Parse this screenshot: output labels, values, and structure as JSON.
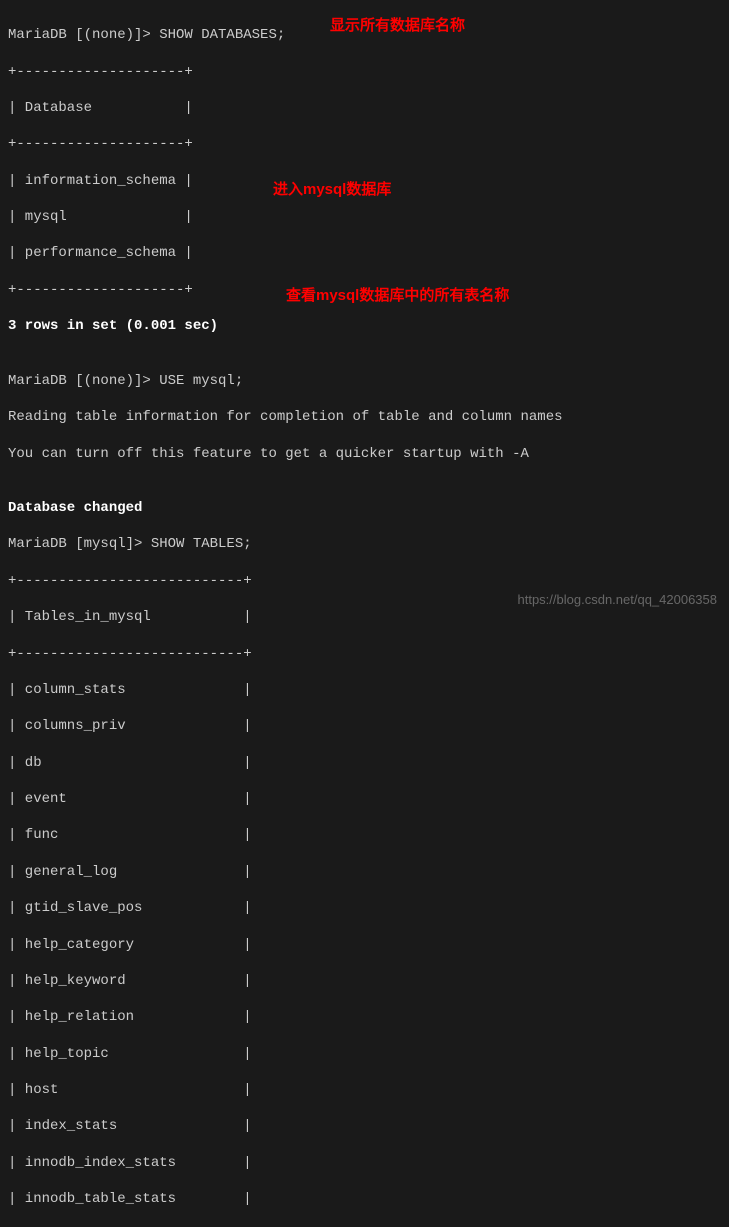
{
  "terminal": {
    "prompt1": "MariaDB [(none)]> SHOW DATABASES;",
    "sep20": "+--------------------+",
    "dbheader": "| Database           |",
    "dbrow1": "| information_schema |",
    "dbrow2": "| mysql              |",
    "dbrow3": "| performance_schema |",
    "rowscount1": "3 rows in set (0.001 sec)",
    "blank": "",
    "prompt2": "MariaDB [(none)]> USE mysql;",
    "reading1": "Reading table information for completion of table and column names",
    "reading2": "You can turn off this feature to get a quicker startup with -A",
    "dbchanged": "Database changed",
    "prompt3": "MariaDB [mysql]> SHOW TABLES;",
    "sep27": "+---------------------------+",
    "tblheader": "| Tables_in_mysql           |",
    "t1": "| column_stats              |",
    "t2": "| columns_priv              |",
    "t3": "| db                        |",
    "t4": "| event                     |",
    "t5": "| func                      |",
    "t6": "| general_log               |",
    "t7": "| gtid_slave_pos            |",
    "t8": "| help_category             |",
    "t9": "| help_keyword              |",
    "t10": "| help_relation             |",
    "t11": "| help_topic                |",
    "t12": "| host                      |",
    "t13": "| index_stats               |",
    "t14": "| innodb_index_stats        |",
    "t15": "| innodb_table_stats        |"
  },
  "annotations": {
    "a1": "显示所有数据库名称",
    "a2": "进入mysql数据库",
    "a3": "查看mysql数据库中的所有表名称"
  },
  "watermark": "https://blog.csdn.net/qq_42006358"
}
